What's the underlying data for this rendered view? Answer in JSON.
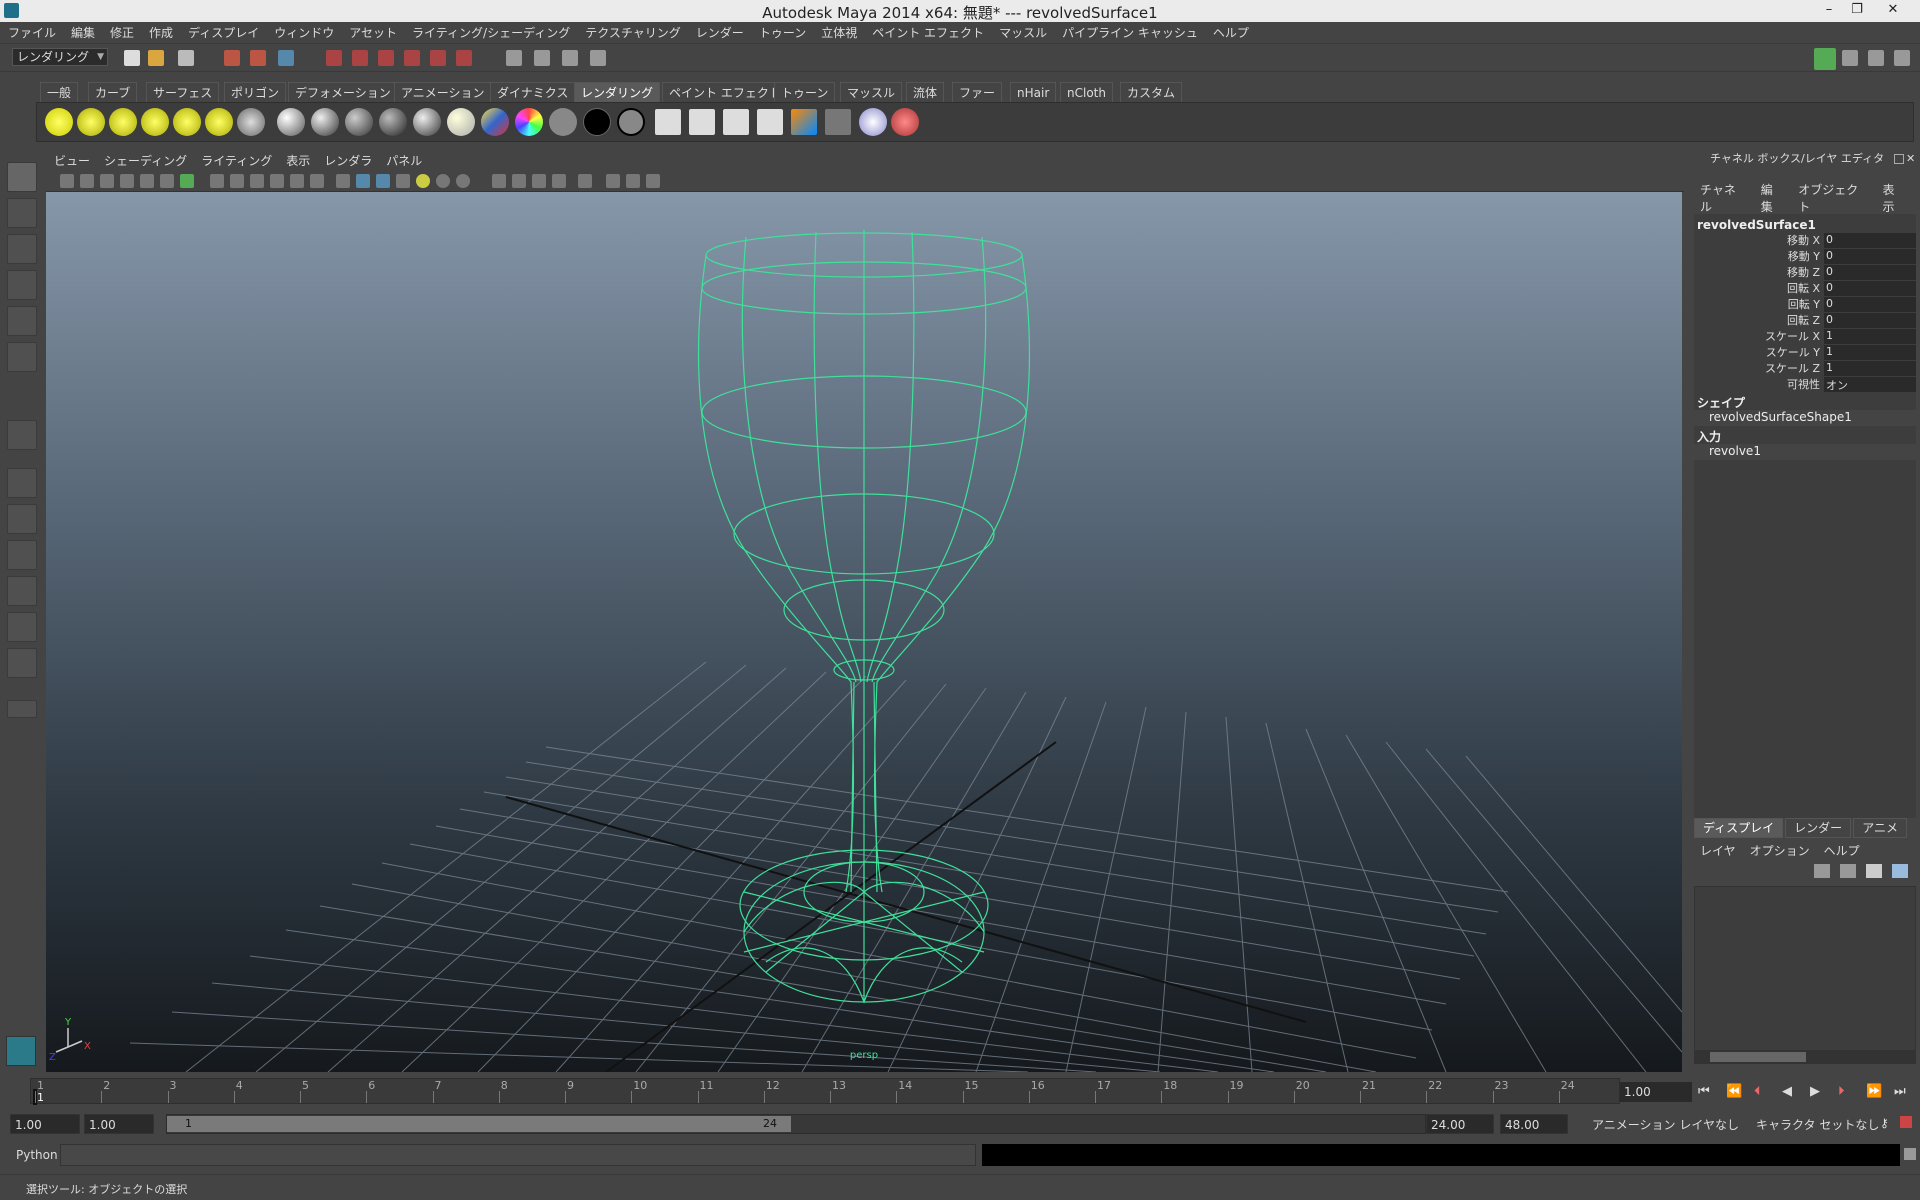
{
  "window": {
    "title": "Autodesk Maya 2014 x64: 無題*   ---   revolvedSurface1",
    "min": "–",
    "max": "❐",
    "close": "✕"
  },
  "menu": [
    "ファイル",
    "編集",
    "修正",
    "作成",
    "ディスプレイ",
    "ウィンドウ",
    "アセット",
    "ライティング/シェーディング",
    "テクスチャリング",
    "レンダー",
    "トゥーン",
    "立体視",
    "ペイント エフェクト",
    "マッスル",
    "パイプライン キャッシュ",
    "ヘルプ"
  ],
  "mode": "レンダリング",
  "shelf_tabs": [
    "一般",
    "カーブ",
    "サーフェス",
    "ポリゴン",
    "デフォメーション",
    "アニメーション",
    "ダイナミクス",
    "レンダリング",
    "ペイント エフェクト",
    "トゥーン",
    "マッスル",
    "流体",
    "ファー",
    "nHair",
    "nCloth",
    "カスタム"
  ],
  "active_shelf_tab": "レンダリング",
  "viewport": {
    "menu": [
      "ビュー",
      "シェーディング",
      "ライティング",
      "表示",
      "レンダラ",
      "パネル"
    ],
    "camera_label": "persp",
    "axis": {
      "y": "Y",
      "x": "X",
      "z": "Z"
    }
  },
  "channel_box": {
    "header": "チャネル ボックス/レイヤ エディタ",
    "menu": [
      "チャネル",
      "編集",
      "オブジェクト",
      "表示"
    ],
    "object": "revolvedSurface1",
    "attributes": [
      {
        "name": "移動 X",
        "value": "0"
      },
      {
        "name": "移動 Y",
        "value": "0"
      },
      {
        "name": "移動 Z",
        "value": "0"
      },
      {
        "name": "回転 X",
        "value": "0"
      },
      {
        "name": "回転 Y",
        "value": "0"
      },
      {
        "name": "回転 Z",
        "value": "0"
      },
      {
        "name": "スケール X",
        "value": "1"
      },
      {
        "name": "スケール Y",
        "value": "1"
      },
      {
        "name": "スケール Z",
        "value": "1"
      },
      {
        "name": "可視性",
        "value": "オン"
      }
    ],
    "shape_header": "シェイプ",
    "shape": "revolvedSurfaceShape1",
    "input_header": "入力",
    "input": "revolve1"
  },
  "layer_editor": {
    "tabs": [
      "ディスプレイ",
      "レンダー",
      "アニメ"
    ],
    "menu": [
      "レイヤ",
      "オプション",
      "ヘルプ"
    ]
  },
  "time_slider": {
    "ticks": [
      "1",
      "2",
      "3",
      "4",
      "5",
      "6",
      "7",
      "8",
      "9",
      "10",
      "11",
      "12",
      "13",
      "14",
      "15",
      "16",
      "17",
      "18",
      "19",
      "20",
      "21",
      "22",
      "23",
      "24"
    ],
    "current": "1",
    "current_frame": "1.00"
  },
  "range": {
    "start": "1.00",
    "playback_start": "1.00",
    "range_start_label": "1",
    "range_end_label": "24",
    "playback_end": "24.00",
    "end": "48.00",
    "anim_layer": "アニメーション レイヤなし",
    "character_set": "キャラクタ セットなし"
  },
  "command_line": {
    "lang": "Python"
  },
  "help_line": "選択ツール: オブジェクトの選択",
  "colors": {
    "wire": "#3fe09a",
    "bg_ui": "#444444"
  }
}
